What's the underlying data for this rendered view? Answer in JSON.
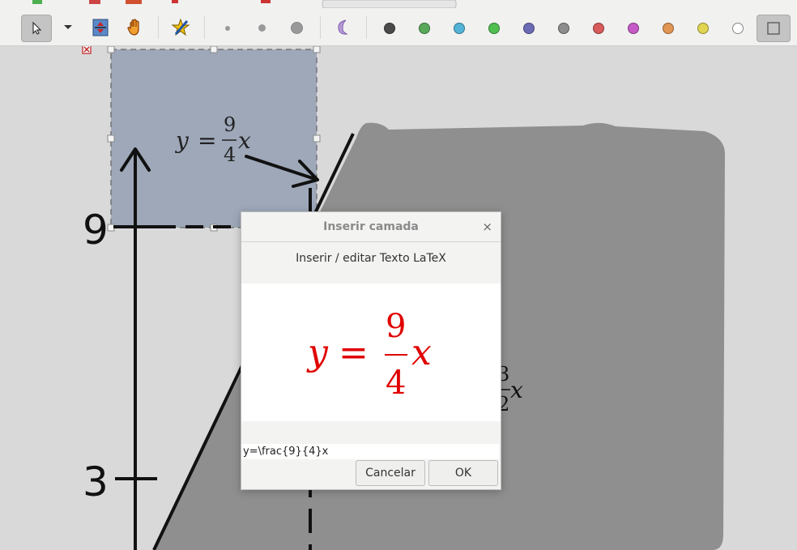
{
  "toolbar": {
    "tools": [
      "select-tool",
      "mode-dropdown",
      "resize-tool",
      "pan-tool",
      "pen-tool"
    ],
    "stroke_sizes": [
      "small",
      "medium",
      "large"
    ],
    "colors": [
      "#4a4a4a",
      "#5aa85a",
      "#54b3d6",
      "#4fbf4f",
      "#6b6bb5",
      "#8c8c8c",
      "#d85a5a",
      "#c65ac6",
      "#e09552",
      "#e0d452",
      "#ffffff"
    ]
  },
  "canvas": {
    "label_9": "9",
    "label_3": "3",
    "selected_formula": "y = 9/4 x",
    "background_formula_partial": "3/2 x"
  },
  "dialog": {
    "title": "Inserir camada",
    "close_symbol": "×",
    "subtitle": "Inserir / editar Texto LaTeX",
    "preview_formula": {
      "lhs": "y",
      "eq": "=",
      "numerator": "9",
      "denominator": "4",
      "var": "x",
      "color": "#e00000"
    },
    "input_value": "y=\\frac{9}{4}x",
    "cancel_label": "Cancelar",
    "ok_label": "OK"
  }
}
